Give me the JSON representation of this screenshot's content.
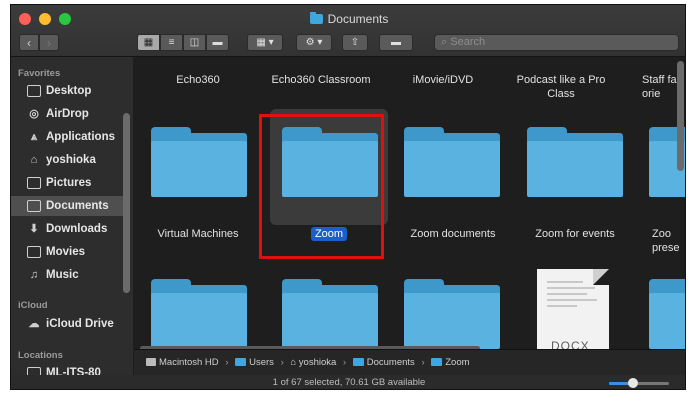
{
  "window": {
    "title": "Documents",
    "traffic_lights": {
      "close": "#fe5f57",
      "minimize": "#febc2e",
      "zoom": "#28c840"
    }
  },
  "toolbar": {
    "back_icon": "chevron-left",
    "forward_icon": "chevron-right",
    "view_icons": [
      "icon-view",
      "list-view",
      "column-view",
      "gallery-view"
    ],
    "group_icon": "group-by",
    "action_icon": "gear",
    "share_icon": "share",
    "tag_icon": "tag",
    "search_placeholder": "Search"
  },
  "sidebar": {
    "favorites_header": "Favorites",
    "favorites": [
      {
        "label": "Desktop",
        "icon": "desktop-icon"
      },
      {
        "label": "AirDrop",
        "icon": "airdrop-icon"
      },
      {
        "label": "Applications",
        "icon": "applications-icon"
      },
      {
        "label": "yoshioka",
        "icon": "home-icon"
      },
      {
        "label": "Pictures",
        "icon": "pictures-icon"
      },
      {
        "label": "Documents",
        "icon": "documents-icon",
        "selected": true
      },
      {
        "label": "Downloads",
        "icon": "downloads-icon"
      },
      {
        "label": "Movies",
        "icon": "movies-icon"
      },
      {
        "label": "Music",
        "icon": "music-icon"
      }
    ],
    "icloud_header": "iCloud",
    "icloud": [
      {
        "label": "iCloud Drive",
        "icon": "cloud-icon"
      }
    ],
    "locations_header": "Locations",
    "locations": [
      {
        "label": "ML-ITS-80",
        "icon": "computer-icon"
      }
    ]
  },
  "main": {
    "row1_labels": [
      "Echo360",
      "Echo360 Classroom",
      "iMovie/iDVD",
      "Podcast like a Pro Class",
      "Staff fa orie"
    ],
    "row2_labels": [
      "Virtual Machines",
      "Zoom",
      "Zoom documents",
      "Zoom for events",
      "Zoo prese"
    ],
    "selected_item": "Zoom",
    "docx_label": "DOCX"
  },
  "pathbar": {
    "items": [
      "Macintosh HD",
      "Users",
      "yoshioka",
      "Documents",
      "Zoom"
    ],
    "separator": "›"
  },
  "statusbar": {
    "text": "1 of 67 selected, 70.61 GB available",
    "icon_size_slider": 0.4
  },
  "annotation": {
    "color": "#e01010"
  }
}
